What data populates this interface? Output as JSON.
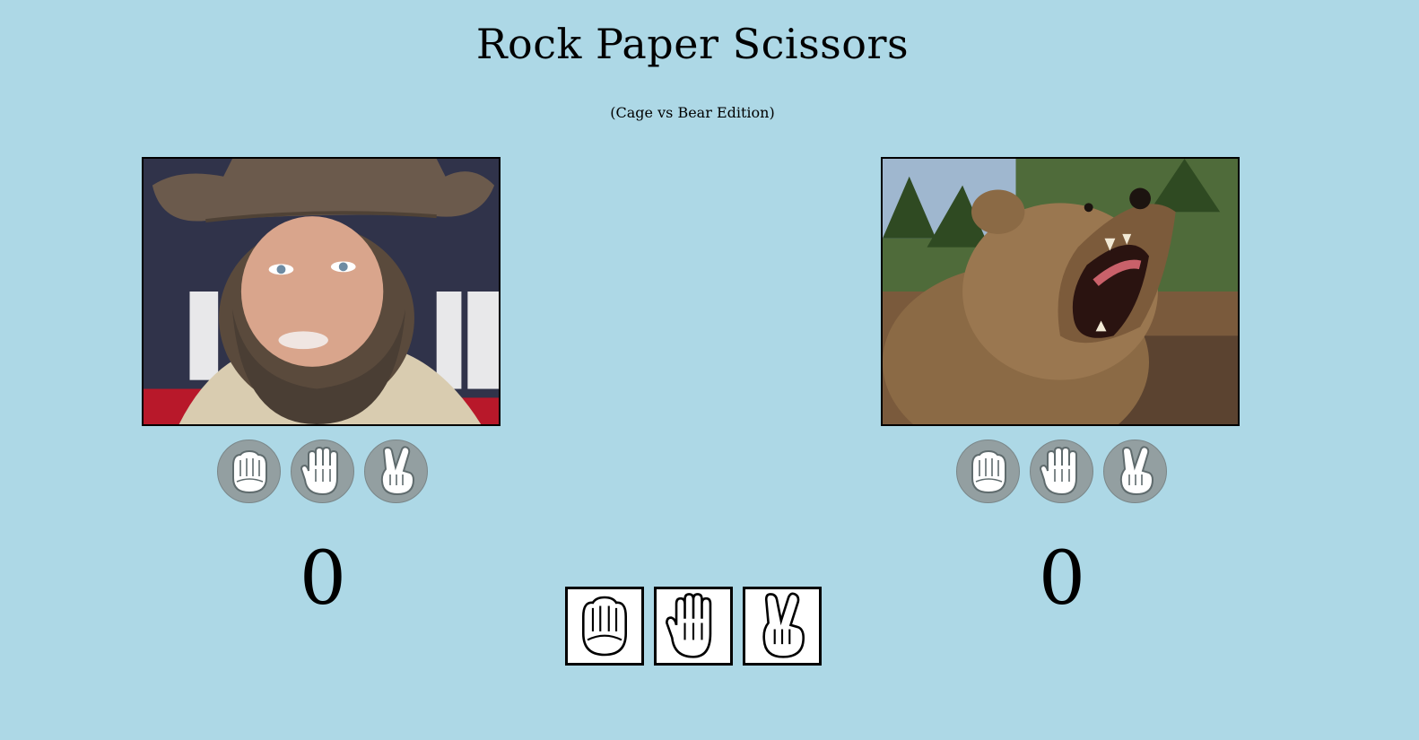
{
  "header": {
    "title": "Rock Paper Scissors",
    "subtitle": "(Cage vs Bear Edition)"
  },
  "players": {
    "cage": {
      "name": "Cage",
      "score": "0"
    },
    "bear": {
      "name": "Bear",
      "score": "0"
    }
  },
  "moves": [
    "rock",
    "paper",
    "scissors"
  ],
  "icons": {
    "rock": "rock-hand-icon",
    "paper": "paper-hand-icon",
    "scissors": "scissors-hand-icon"
  },
  "colors": {
    "background": "#add8e6",
    "choice_circle": "#939fa1",
    "move_button_bg": "#ffffff",
    "border": "#000000"
  }
}
